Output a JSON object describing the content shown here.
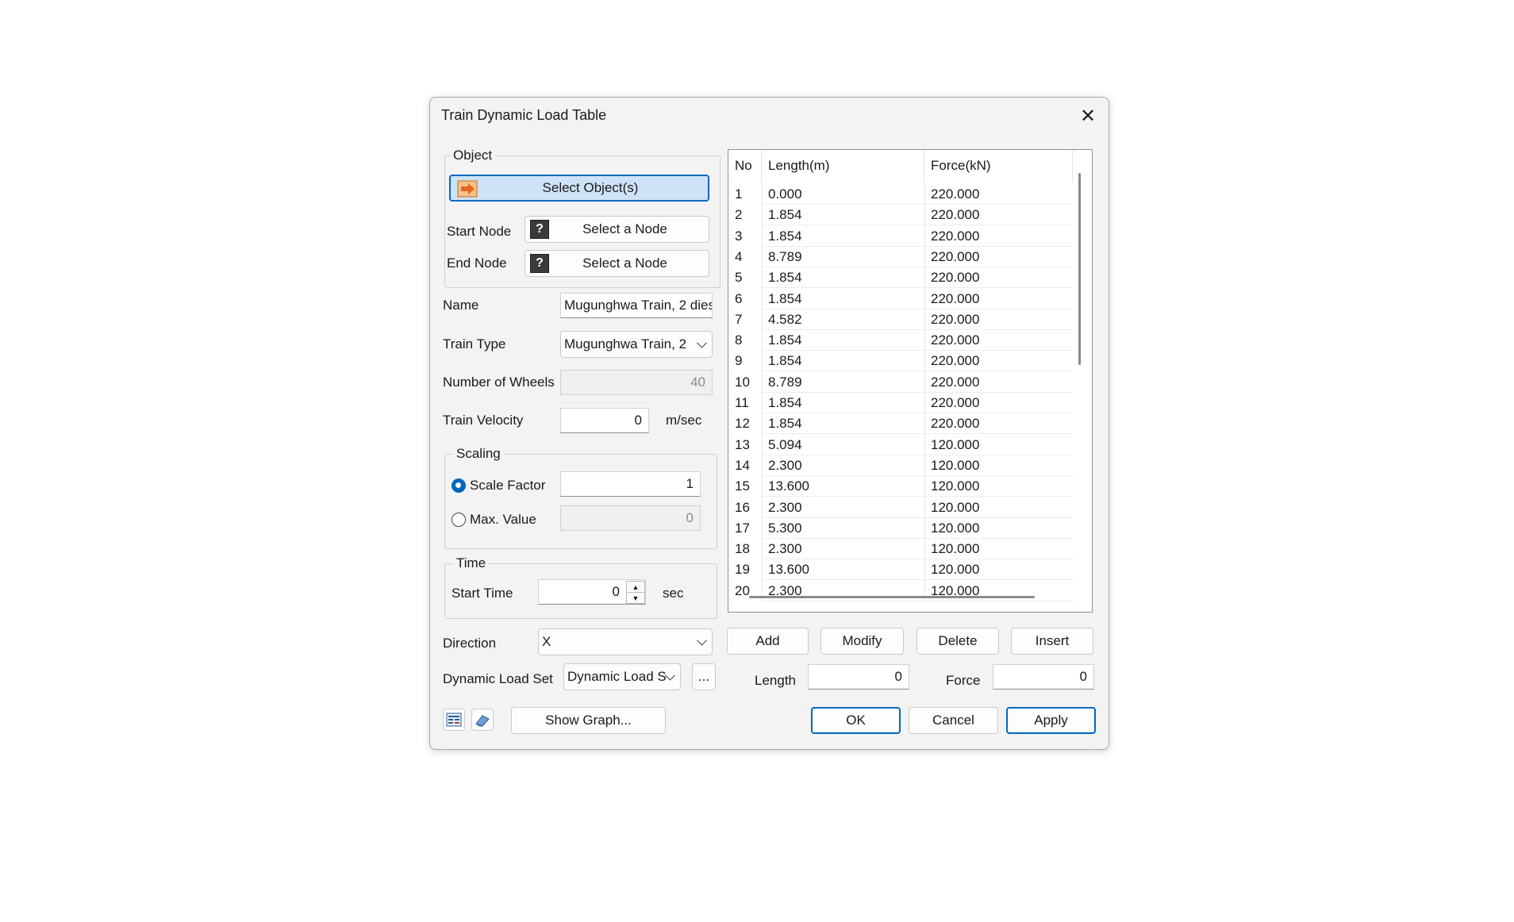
{
  "window": {
    "title": "Train Dynamic Load Table"
  },
  "object_group": {
    "label": "Object",
    "select_button": "Select Object(s)",
    "start_node_label": "Start Node",
    "start_node_button": "Select a Node",
    "end_node_label": "End Node",
    "end_node_button": "Select a Node"
  },
  "fields": {
    "name_label": "Name",
    "name_value": "Mugunghwa Train, 2 dies",
    "train_type_label": "Train Type",
    "train_type_value": "Mugunghwa Train, 2",
    "wheels_label": "Number of Wheels",
    "wheels_value": "40",
    "velocity_label": "Train Velocity",
    "velocity_value": "0",
    "velocity_unit": "m/sec"
  },
  "scaling": {
    "label": "Scaling",
    "scale_factor_label": "Scale Factor",
    "scale_factor_value": "1",
    "max_value_label": "Max. Value",
    "max_value_value": "0",
    "selected": "Scale Factor"
  },
  "time": {
    "label": "Time",
    "start_time_label": "Start Time",
    "start_time_value": "0",
    "unit": "sec"
  },
  "direction": {
    "label": "Direction",
    "value": "X"
  },
  "load_set": {
    "label": "Dynamic Load Set",
    "value": "Dynamic Load S",
    "browse": "..."
  },
  "table": {
    "headers": [
      "No",
      "Length(m)",
      "Force(kN)"
    ],
    "rows": [
      [
        "1",
        "0.000",
        "220.000"
      ],
      [
        "2",
        "1.854",
        "220.000"
      ],
      [
        "3",
        "1.854",
        "220.000"
      ],
      [
        "4",
        "8.789",
        "220.000"
      ],
      [
        "5",
        "1.854",
        "220.000"
      ],
      [
        "6",
        "1.854",
        "220.000"
      ],
      [
        "7",
        "4.582",
        "220.000"
      ],
      [
        "8",
        "1.854",
        "220.000"
      ],
      [
        "9",
        "1.854",
        "220.000"
      ],
      [
        "10",
        "8.789",
        "220.000"
      ],
      [
        "11",
        "1.854",
        "220.000"
      ],
      [
        "12",
        "1.854",
        "220.000"
      ],
      [
        "13",
        "5.094",
        "120.000"
      ],
      [
        "14",
        "2.300",
        "120.000"
      ],
      [
        "15",
        "13.600",
        "120.000"
      ],
      [
        "16",
        "2.300",
        "120.000"
      ],
      [
        "17",
        "5.300",
        "120.000"
      ],
      [
        "18",
        "2.300",
        "120.000"
      ],
      [
        "19",
        "13.600",
        "120.000"
      ],
      [
        "20",
        "2.300",
        "120.000"
      ]
    ]
  },
  "table_buttons": {
    "add": "Add",
    "modify": "Modify",
    "delete": "Delete",
    "insert": "Insert"
  },
  "entry": {
    "length_label": "Length",
    "length_value": "0",
    "force_label": "Force",
    "force_value": "0"
  },
  "footer": {
    "show_graph": "Show Graph...",
    "ok": "OK",
    "cancel": "Cancel",
    "apply": "Apply"
  },
  "colors": {
    "accent": "#0067c0",
    "selected_button_bg": "#cfe3f7",
    "dialog_bg": "#f3f3f3"
  }
}
